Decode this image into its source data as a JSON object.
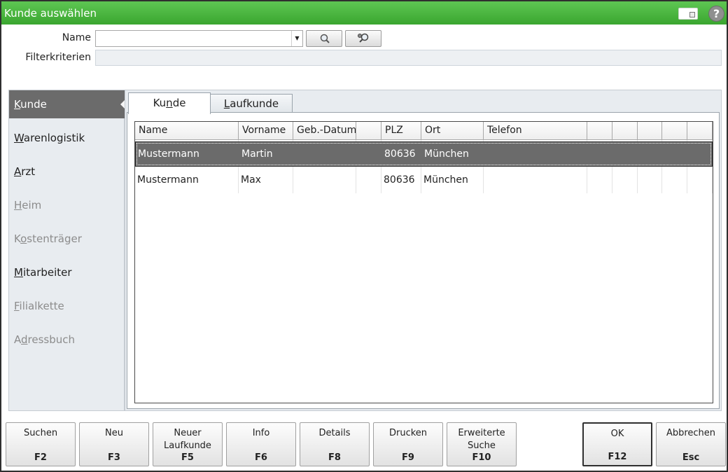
{
  "window": {
    "title": "Kunde auswählen"
  },
  "titlebar_icons": {
    "screen": "screen-toggle-icon",
    "help": "help-icon",
    "help_glyph": "?"
  },
  "search": {
    "name_label": "Name",
    "name_value": "",
    "filter_label": "Filterkriterien",
    "filter_value": "",
    "search_icon": "magnifier-icon",
    "advanced_search_icon": "magnifier-gear-icon"
  },
  "sidebar": {
    "items": [
      {
        "accel": "K",
        "rest": "unde",
        "pre": "",
        "state": "active"
      },
      {
        "accel": "W",
        "rest": "arenlogistik",
        "pre": "",
        "state": "enabled"
      },
      {
        "accel": "A",
        "rest": "rzt",
        "pre": "",
        "state": "enabled"
      },
      {
        "accel": "H",
        "rest": "eim",
        "pre": "",
        "state": "disabled"
      },
      {
        "accel": "o",
        "rest": "stenträger",
        "pre": "K",
        "state": "disabled"
      },
      {
        "accel": "M",
        "rest": "itarbeiter",
        "pre": "",
        "state": "enabled"
      },
      {
        "accel": "F",
        "rest": "ilialkette",
        "pre": "",
        "state": "disabled"
      },
      {
        "accel": "d",
        "rest": "ressbuch",
        "pre": "A",
        "state": "disabled"
      }
    ]
  },
  "tabs": [
    {
      "pre": "Ku",
      "accel": "n",
      "rest": "de"
    },
    {
      "pre": "",
      "accel": "L",
      "rest": "aufkunde"
    }
  ],
  "table": {
    "columns": [
      "Name",
      "Vorname",
      "Geb.-Datum",
      "",
      "PLZ",
      "Ort",
      "Telefon",
      "",
      "",
      "",
      "",
      ""
    ],
    "rows": [
      {
        "cells": [
          "Mustermann",
          "Martin",
          "",
          "",
          "80636",
          "München",
          "",
          "",
          "",
          "",
          "",
          ""
        ],
        "selected": true
      },
      {
        "cells": [
          "Mustermann",
          "Max",
          "",
          "",
          "80636",
          "München",
          "",
          "",
          "",
          "",
          "",
          ""
        ],
        "selected": false
      }
    ]
  },
  "buttons": [
    {
      "label": "Suchen",
      "label2": "",
      "key": "F2"
    },
    {
      "label": "Neu",
      "label2": "",
      "key": "F3"
    },
    {
      "label": "Neuer",
      "label2": "Laufkunde",
      "key": "F5"
    },
    {
      "label": "Info",
      "label2": "",
      "key": "F6"
    },
    {
      "label": "Details",
      "label2": "",
      "key": "F8"
    },
    {
      "label": "Drucken",
      "label2": "",
      "key": "F9"
    },
    {
      "label": "Erweiterte",
      "label2": "Suche",
      "key": "F10"
    },
    {
      "label": "OK",
      "label2": "",
      "key": "F12"
    },
    {
      "label": "Abbrechen",
      "label2": "",
      "key": "Esc"
    }
  ]
}
